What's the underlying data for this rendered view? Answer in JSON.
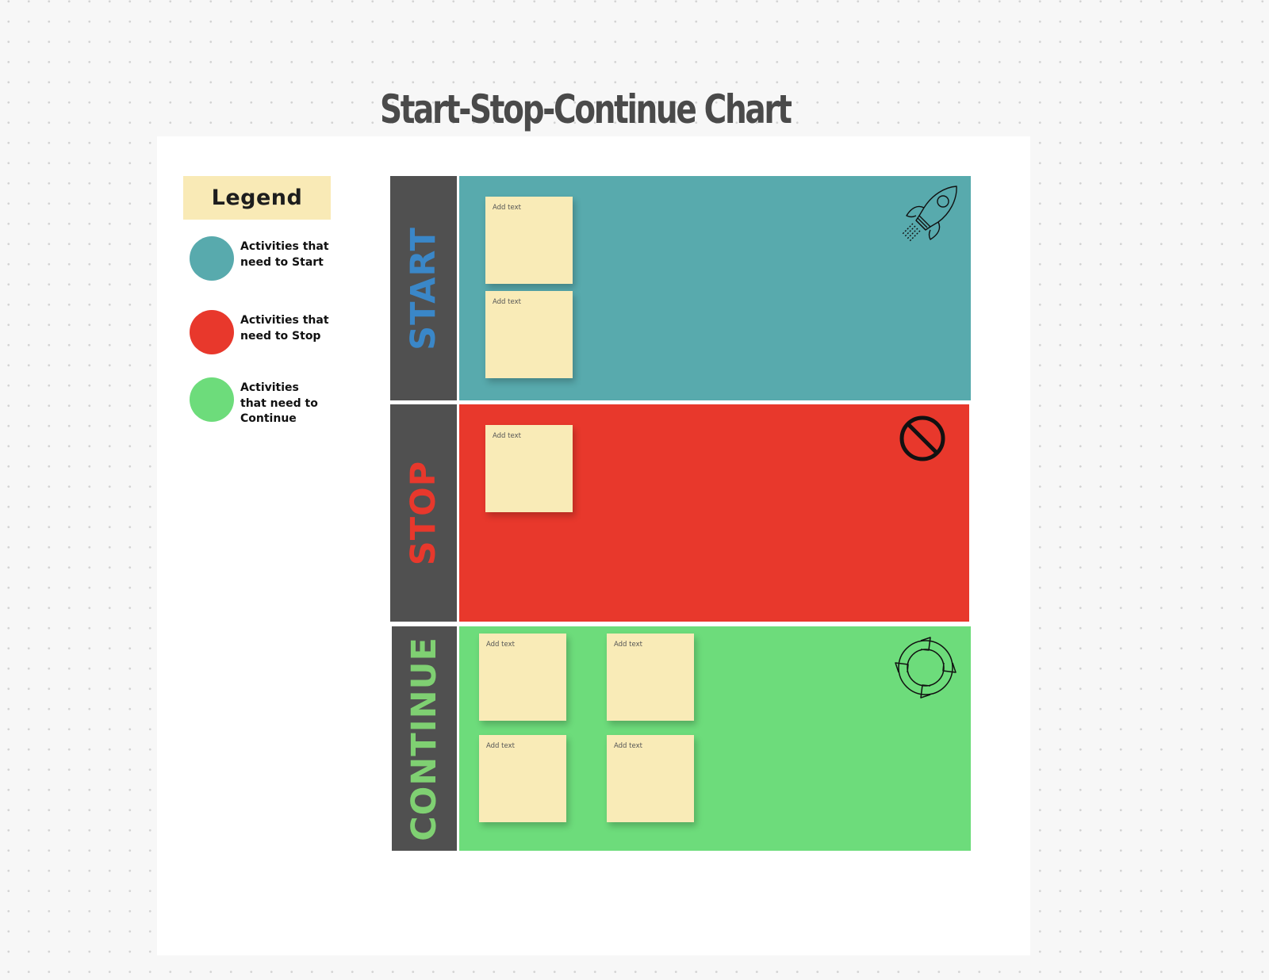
{
  "title": "Start-Stop-Continue Chart",
  "legend": {
    "title": "Legend",
    "items": [
      {
        "label": "Activities that need to Start",
        "color": "#58aaad"
      },
      {
        "label": "Activities that need to Stop",
        "color": "#e8382c"
      },
      {
        "label": "Activities that need to Continue",
        "color": "#6ddc7b"
      }
    ]
  },
  "rows": [
    {
      "label": "START",
      "label_color": "#3a87c8",
      "bg_color": "#58aaad",
      "icon": "rocket-icon",
      "notes": [
        "Add text",
        "Add text"
      ]
    },
    {
      "label": "STOP",
      "label_color": "#e8382c",
      "bg_color": "#e8382c",
      "icon": "prohibited-icon",
      "notes": [
        "Add text"
      ]
    },
    {
      "label": "CONTINUE",
      "label_color": "#7fd072",
      "bg_color": "#6ddc7b",
      "icon": "cycle-arrows-icon",
      "notes": [
        "Add text",
        "Add text",
        "Add text",
        "Add text"
      ]
    }
  ],
  "colors": {
    "label_column": "#505050",
    "sticky_note": "#f9ebb7",
    "legend_title_bg": "#f9eab6"
  }
}
